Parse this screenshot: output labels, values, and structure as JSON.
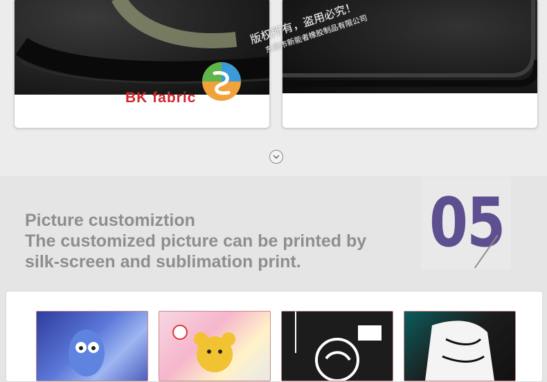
{
  "section_top": {
    "left_caption": "BK fabric",
    "watermark_line1": "版权所有，盗用必究！",
    "watermark_line2": "东莞市新能者橡胶制品有限公司"
  },
  "section_05": {
    "number": "05",
    "title_lines": [
      "Picture customiztion",
      "The customized picture can be printed by",
      "silk-screen and sublimation print."
    ]
  },
  "thumbnails": [
    {
      "name": "animated-character-mat"
    },
    {
      "name": "cartoon-bear-mat"
    },
    {
      "name": "logo-badge-mat"
    },
    {
      "name": "muscle-figure-mat"
    }
  ],
  "colors": {
    "accent_purple": "#5e4f90",
    "caption_red": "#d2262d",
    "title_gray": "#8e8e8e"
  },
  "icons": {
    "scroll": "chevron-down-icon",
    "brand": "swirl-logo-icon"
  }
}
